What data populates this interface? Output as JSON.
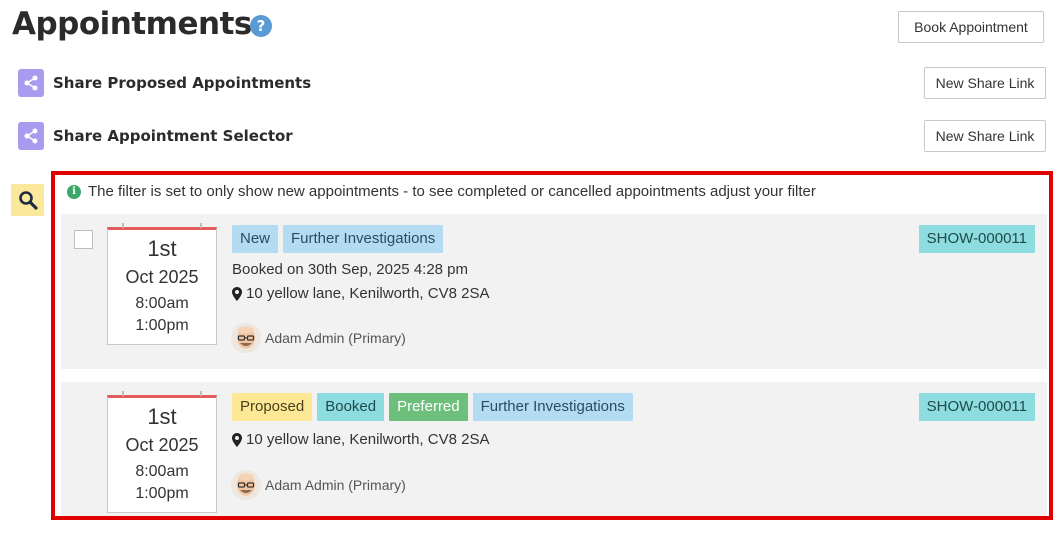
{
  "header": {
    "title": "Appointments",
    "help_icon": "?",
    "book_button": "Book Appointment"
  },
  "share": [
    {
      "label": "Share Proposed Appointments",
      "button": "New Share Link",
      "icon": "share-icon"
    },
    {
      "label": "Share Appointment Selector",
      "button": "New Share Link",
      "icon": "share-icon"
    }
  ],
  "filter": {
    "info_icon": "i",
    "message": "The filter is set to only show new appointments - to see completed or cancelled appointments adjust your filter"
  },
  "appointments": [
    {
      "selectable": true,
      "day": "1st",
      "month": "Oct 2025",
      "start": "8:00am",
      "end": "1:00pm",
      "tags": [
        {
          "label": "New",
          "style": "blue"
        },
        {
          "label": "Further Investigations",
          "style": "blue"
        }
      ],
      "reference": "SHOW-000011",
      "booked_on": "Booked on 30th Sep, 2025 4:28 pm",
      "address": "10 yellow lane, Kenilworth, CV8 2SA",
      "attendee": "Adam Admin (Primary)"
    },
    {
      "selectable": false,
      "day": "1st",
      "month": "Oct 2025",
      "start": "8:00am",
      "end": "1:00pm",
      "tags": [
        {
          "label": "Proposed",
          "style": "yellow"
        },
        {
          "label": "Booked",
          "style": "teal"
        },
        {
          "label": "Preferred",
          "style": "green"
        },
        {
          "label": "Further Investigations",
          "style": "blue"
        }
      ],
      "reference": "SHOW-000011",
      "address": "10 yellow lane, Kenilworth, CV8 2SA",
      "attendee": "Adam Admin (Primary)"
    }
  ],
  "colors": {
    "highlight_border": "#e00000",
    "share_icon_bg": "#a99cf0",
    "search_bg": "#fbe89b",
    "calendar_top": "#e35b5b"
  }
}
